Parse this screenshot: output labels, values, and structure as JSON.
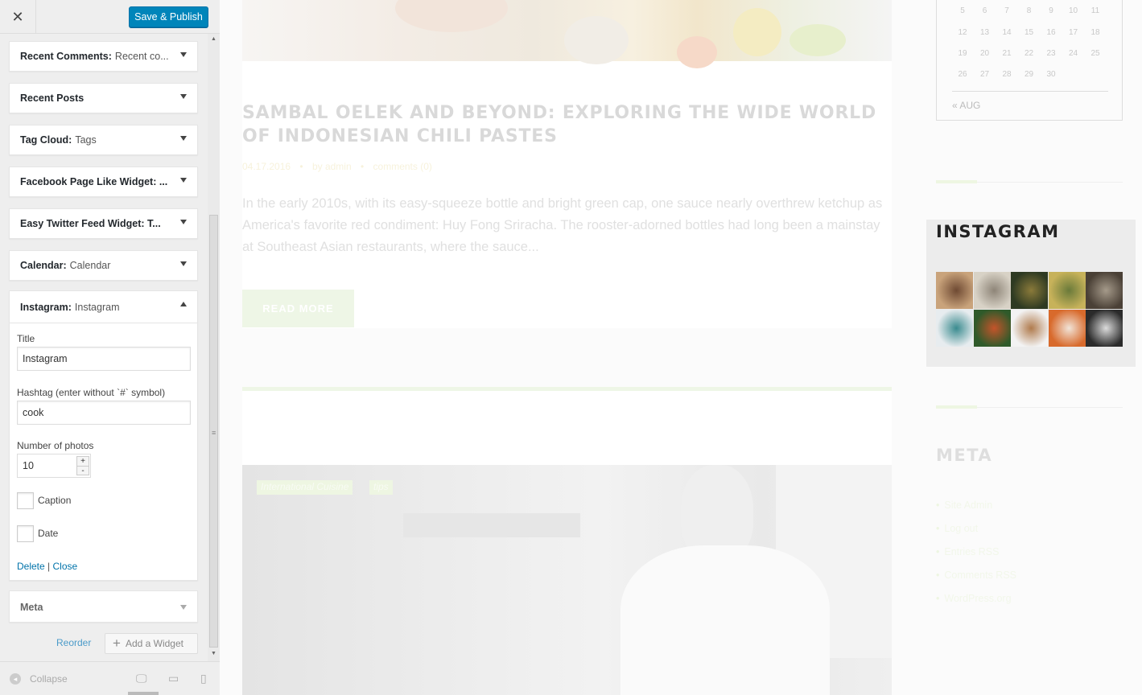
{
  "topbar": {
    "close_glyph": "✕",
    "publish_label": "Save & Publish"
  },
  "widgets": [
    {
      "name": "Recent Comments:",
      "sub": "Recent co..."
    },
    {
      "name": "Recent Posts",
      "sub": ""
    },
    {
      "name": "Tag Cloud:",
      "sub": "Tags"
    },
    {
      "name": "Facebook Page Like Widget: ...",
      "sub": ""
    },
    {
      "name": "Easy Twitter Feed Widget: T...",
      "sub": ""
    },
    {
      "name": "Calendar:",
      "sub": "Calendar"
    }
  ],
  "instagram_widget": {
    "name": "Instagram:",
    "sub": "Instagram",
    "title_label": "Title",
    "title_value": "Instagram",
    "hashtag_label": "Hashtag (enter without `#` symbol)",
    "hashtag_value": "cook",
    "photos_label": "Number of photos",
    "photos_value": "10",
    "step_up": "+",
    "step_down": "-",
    "caption_label": "Caption",
    "date_label": "Date",
    "delete_link": "Delete",
    "link_sep": "|",
    "close_link": "Close"
  },
  "meta_widget": {
    "name": "Meta"
  },
  "actions": {
    "reorder": "Reorder",
    "add_plus": "+",
    "add_widget": "Add a Widget"
  },
  "footer": {
    "collapse": "Collapse",
    "collapse_icon": "◂",
    "desktop_icon": "🖵",
    "tablet_icon": "▭",
    "mobile_icon": "▯"
  },
  "scrollbar": {
    "up": "▲",
    "grip": "≡",
    "down": "▼"
  },
  "post": {
    "title": "SAMBAL OELEK AND BEYOND: EXPLORING THE WIDE WORLD OF INDONESIAN CHILI PASTES",
    "date": "04.17.2016",
    "author": "by admin",
    "comments": "comments (0)",
    "bullet": "•",
    "excerpt": "In the early 2010s, with its easy-squeeze bottle and bright green cap, one sauce nearly overthrew ketchup as America's favorite red condiment: Huy Fong Sriracha. The rooster-adorned bottles had long been a mainstay at Southeast Asian restaurants, where the sauce...",
    "read_more": "READ MORE"
  },
  "post2": {
    "tags": [
      "International Cuisine",
      "tips"
    ]
  },
  "calendar": {
    "rows": [
      [
        "5",
        "6",
        "7",
        "8",
        "9",
        "10",
        "11"
      ],
      [
        "12",
        "13",
        "14",
        "15",
        "16",
        "17",
        "18"
      ],
      [
        "19",
        "20",
        "21",
        "22",
        "23",
        "24",
        "25"
      ],
      [
        "26",
        "27",
        "28",
        "29",
        "30",
        "",
        ""
      ]
    ],
    "prev": "« AUG"
  },
  "instagram_box": {
    "title": "INSTAGRAM"
  },
  "meta": {
    "title": "META",
    "links": [
      "Site Admin",
      "Log out",
      "Entries RSS",
      "Comments RSS",
      "WordPress.org"
    ]
  },
  "colors": {
    "accent": "#0085ba",
    "link": "#0073aa",
    "green_accent": "#eef6e2"
  }
}
